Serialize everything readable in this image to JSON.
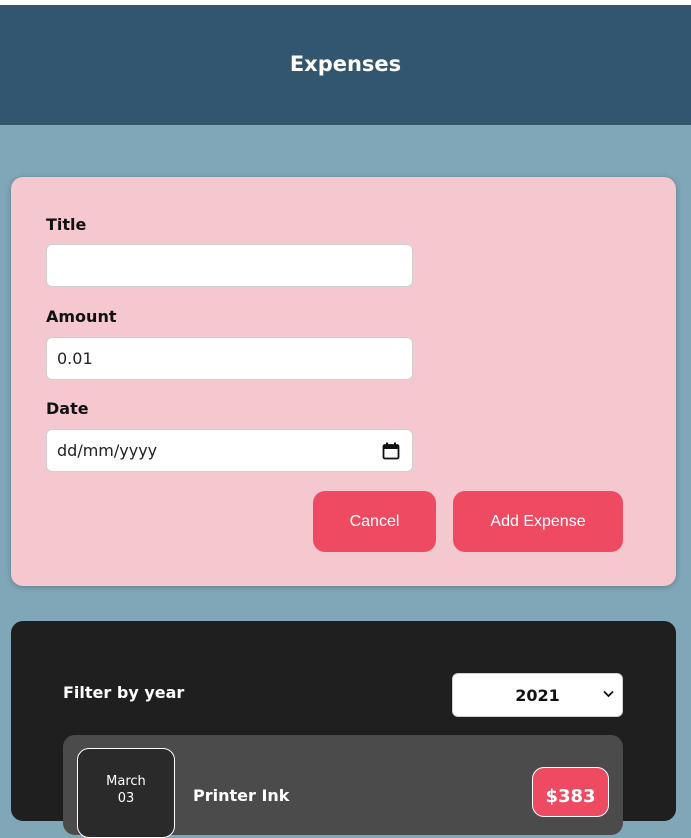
{
  "header": {
    "title": "Expenses"
  },
  "form": {
    "title_label": "Title",
    "title_value": "",
    "amount_label": "Amount",
    "amount_value": "0.01",
    "date_label": "Date",
    "date_placeholder": "dd/mm/yyyy",
    "cancel_label": "Cancel",
    "submit_label": "Add Expense"
  },
  "filter": {
    "label": "Filter by year",
    "selected_year": "2021"
  },
  "expenses": [
    {
      "month": "March",
      "day": "03",
      "title": "Printer Ink",
      "price": "$383"
    }
  ],
  "colors": {
    "header": "#32566f",
    "background": "#7fa7b7",
    "form_card": "#f5c7cf",
    "accent": "#ee4b63",
    "list_card": "#1f1f1f",
    "item": "#4b4b4b"
  }
}
